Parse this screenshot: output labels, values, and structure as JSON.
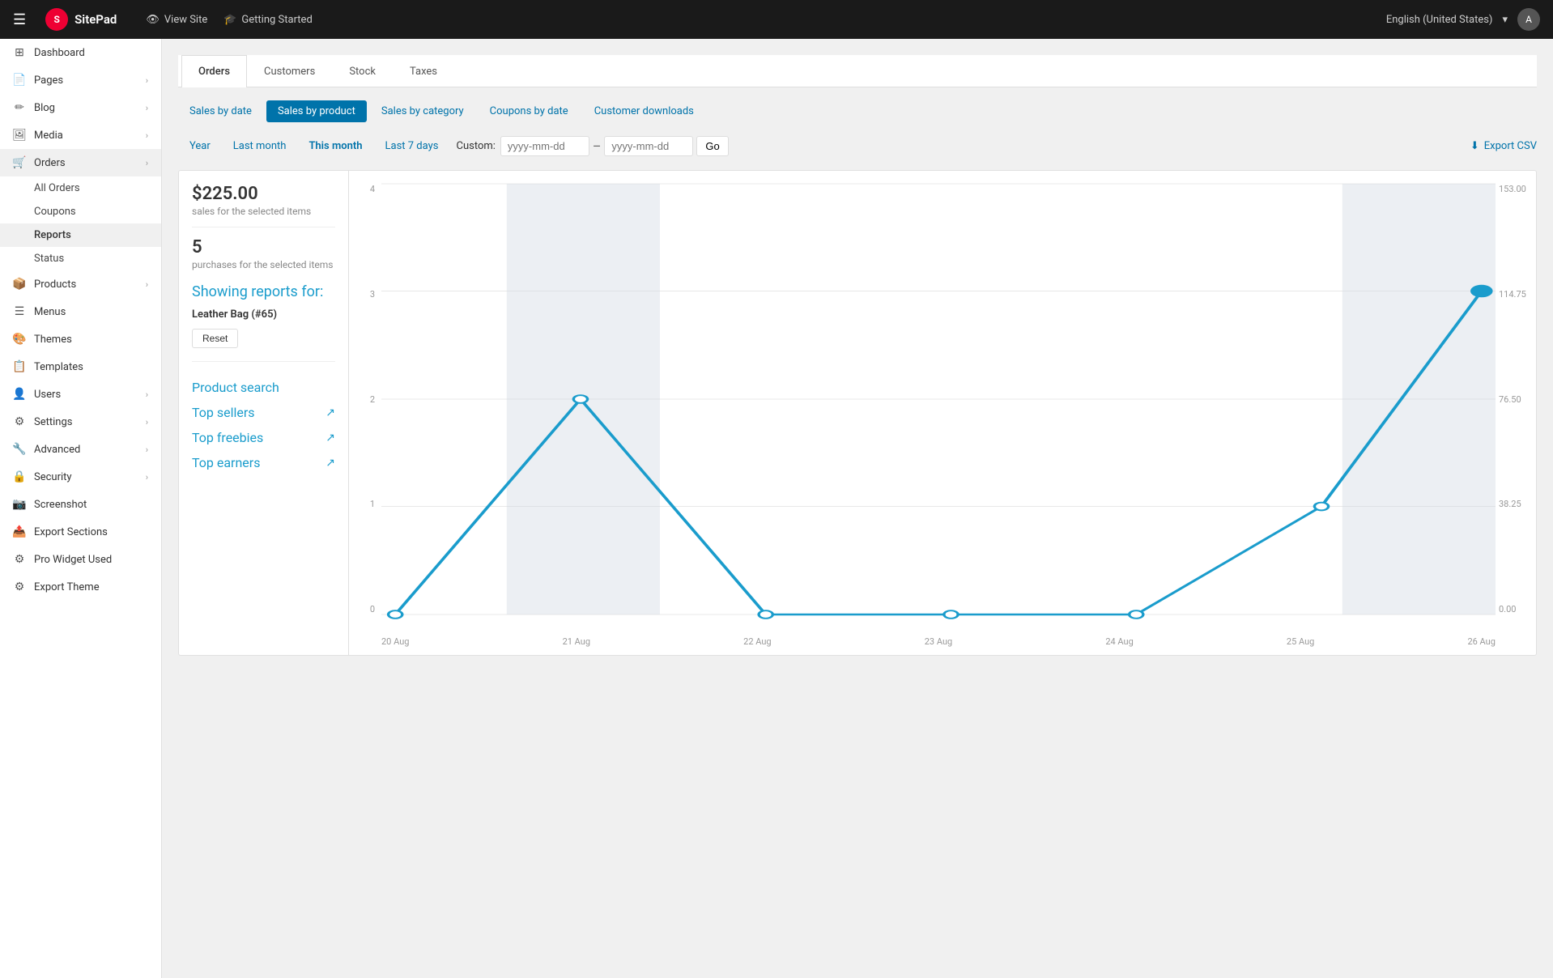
{
  "topbar": {
    "menu_icon": "☰",
    "logo_text": "SitePad",
    "logo_icon": "S",
    "nav_items": [
      {
        "icon": "👁",
        "label": "View Site"
      },
      {
        "icon": "🎓",
        "label": "Getting Started"
      }
    ],
    "language": "English (United States)",
    "avatar": "A"
  },
  "sidebar": {
    "items": [
      {
        "id": "dashboard",
        "icon": "⊞",
        "label": "Dashboard",
        "has_children": false
      },
      {
        "id": "pages",
        "icon": "📄",
        "label": "Pages",
        "has_children": true
      },
      {
        "id": "blog",
        "icon": "✏",
        "label": "Blog",
        "has_children": true
      },
      {
        "id": "media",
        "icon": "🖼",
        "label": "Media",
        "has_children": true
      },
      {
        "id": "orders",
        "icon": "🛒",
        "label": "Orders",
        "has_children": true
      }
    ],
    "orders_sub": [
      {
        "id": "all-orders",
        "label": "All Orders"
      },
      {
        "id": "coupons",
        "label": "Coupons"
      },
      {
        "id": "reports",
        "label": "Reports",
        "active": true
      },
      {
        "id": "status",
        "label": "Status"
      }
    ],
    "items2": [
      {
        "id": "products",
        "icon": "📦",
        "label": "Products",
        "has_children": true
      },
      {
        "id": "menus",
        "icon": "☰",
        "label": "Menus",
        "has_children": false
      },
      {
        "id": "themes",
        "icon": "🎨",
        "label": "Themes",
        "has_children": false
      },
      {
        "id": "templates",
        "icon": "📋",
        "label": "Templates",
        "has_children": false
      },
      {
        "id": "users",
        "icon": "👤",
        "label": "Users",
        "has_children": true
      },
      {
        "id": "settings",
        "icon": "⚙",
        "label": "Settings",
        "has_children": true
      },
      {
        "id": "advanced",
        "icon": "🔧",
        "label": "Advanced",
        "has_children": true
      },
      {
        "id": "security",
        "icon": "🔒",
        "label": "Security",
        "has_children": true
      },
      {
        "id": "screenshot",
        "icon": "📷",
        "label": "Screenshot",
        "has_children": false
      },
      {
        "id": "export-sections",
        "icon": "📤",
        "label": "Export Sections",
        "has_children": false
      },
      {
        "id": "pro-widget-used",
        "icon": "⚙",
        "label": "Pro Widget Used",
        "has_children": false
      },
      {
        "id": "export-theme",
        "icon": "⚙",
        "label": "Export Theme",
        "has_children": false
      }
    ]
  },
  "tabs": {
    "items": [
      {
        "id": "orders",
        "label": "Orders"
      },
      {
        "id": "customers",
        "label": "Customers"
      },
      {
        "id": "stock",
        "label": "Stock"
      },
      {
        "id": "taxes",
        "label": "Taxes"
      }
    ],
    "active": "orders"
  },
  "sub_nav": {
    "items": [
      {
        "id": "sales-by-date",
        "label": "Sales by date"
      },
      {
        "id": "sales-by-product",
        "label": "Sales by product",
        "active": true
      },
      {
        "id": "sales-by-category",
        "label": "Sales by category"
      },
      {
        "id": "coupons-by-date",
        "label": "Coupons by date"
      },
      {
        "id": "customer-downloads",
        "label": "Customer downloads"
      }
    ]
  },
  "period_nav": {
    "items": [
      {
        "id": "year",
        "label": "Year"
      },
      {
        "id": "last-month",
        "label": "Last month"
      },
      {
        "id": "this-month",
        "label": "This month",
        "active": true
      },
      {
        "id": "last-7-days",
        "label": "Last 7 days"
      }
    ],
    "custom_label": "Custom:",
    "custom_placeholder1": "yyyy-mm-dd",
    "custom_placeholder2": "yyyy-mm-dd",
    "go_label": "Go",
    "export_label": "Export CSV"
  },
  "stats": {
    "amount": "$225.00",
    "amount_label": "sales for the selected items",
    "count": "5",
    "count_label": "purchases for the selected items"
  },
  "showing": {
    "title": "Showing reports for:",
    "product": "Leather Bag (#65)",
    "reset_label": "Reset"
  },
  "panel_links": [
    {
      "id": "product-search",
      "label": "Product search",
      "icon": ""
    },
    {
      "id": "top-sellers",
      "label": "Top sellers",
      "icon": "↗"
    },
    {
      "id": "top-freebies",
      "label": "Top freebies",
      "icon": "↗"
    },
    {
      "id": "top-earners",
      "label": "Top earners",
      "icon": "↗"
    }
  ],
  "chart": {
    "y_labels": [
      "4",
      "3",
      "2",
      "1",
      "0"
    ],
    "y_right_labels": [
      "153.00",
      "114.75",
      "76.50",
      "38.25",
      "0.00"
    ],
    "x_labels": [
      "20 Aug",
      "21 Aug",
      "22 Aug",
      "23 Aug",
      "24 Aug",
      "25 Aug",
      "26 Aug"
    ],
    "data_points": [
      {
        "date": "20 Aug",
        "value": 0,
        "money": 0
      },
      {
        "date": "21 Aug",
        "value": 2,
        "money": 76.5
      },
      {
        "date": "22 Aug",
        "value": 0,
        "money": 0
      },
      {
        "date": "23 Aug",
        "value": 0,
        "money": 0
      },
      {
        "date": "24 Aug",
        "value": 0,
        "money": 0
      },
      {
        "date": "25 Aug",
        "value": 1,
        "money": 38.25
      },
      {
        "date": "26 Aug",
        "value": 3,
        "money": 114.75
      }
    ],
    "highlight_start": "21 Aug",
    "highlight_end": "26 Aug"
  }
}
